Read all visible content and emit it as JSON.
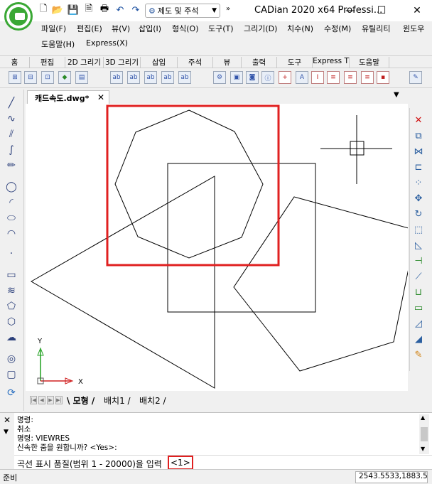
{
  "title": {
    "app_title": "CADian 2020 x64 Professi...",
    "style_combo": "제도 및 주석",
    "minimize": "—",
    "maximize": "☐",
    "close": "✕"
  },
  "menu": {
    "items": [
      "파일(F)",
      "편집(E)",
      "뷰(V)",
      "삽입(I)",
      "형식(O)",
      "도구(T)",
      "그리기(D)",
      "치수(N)",
      "수정(M)",
      "유틸리티",
      "윈도우"
    ],
    "row2": [
      "도움말(H)",
      "Express(X)"
    ]
  },
  "ribbon": {
    "tabs": [
      "홈",
      "편집",
      "2D 그리기",
      "3D 그리기",
      "삽입",
      "주석",
      "뷰",
      "출력",
      "도구",
      "Express T",
      "도움말"
    ]
  },
  "document": {
    "tab_label": "캐드속도.dwg*",
    "close": "✕"
  },
  "ucs": {
    "y_label": "Y",
    "x_label": "X"
  },
  "layout_tabs": [
    "모형",
    "배치1",
    "배치2"
  ],
  "command": {
    "history": [
      "명령:",
      "취소",
      "명령: VIEWRES",
      "신속한 줌을 원합니까? <Yes>:"
    ],
    "prompt": "곡선 표시 품질(범위 1 - 20000)을 입력",
    "default_value": "<1>"
  },
  "status": {
    "text": "준비",
    "coords": "2543.5533,1883.5"
  },
  "colors": {
    "highlight": "#e02020",
    "brand_green": "#3aa835"
  }
}
